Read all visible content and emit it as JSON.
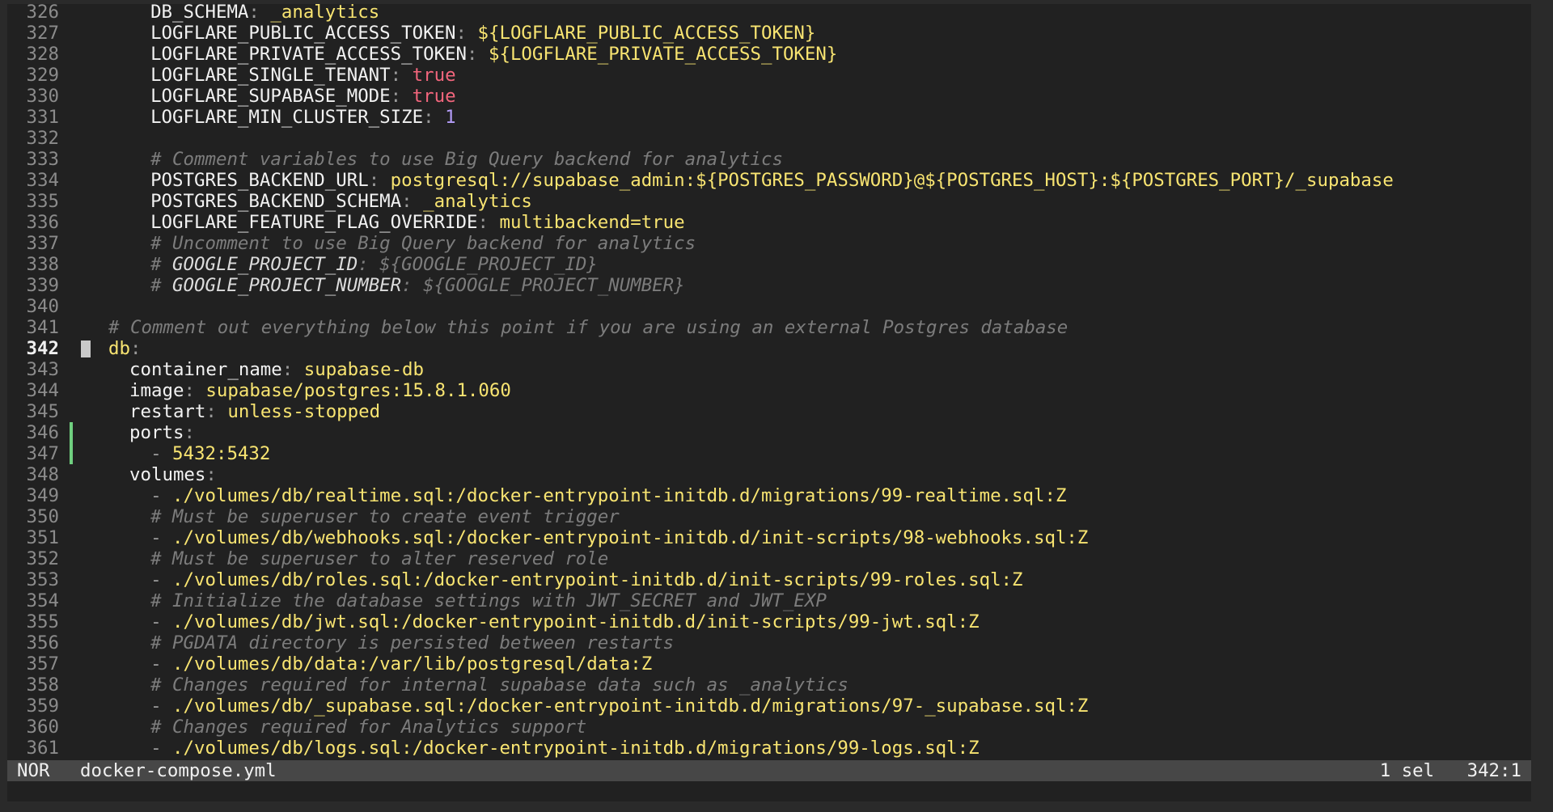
{
  "editor": {
    "cursor_line": 342,
    "lines": [
      {
        "n": "326",
        "indent": 4,
        "tokens": [
          {
            "t": "DB_SCHEMA",
            "c": "key"
          },
          {
            "t": ": ",
            "c": "punct"
          },
          {
            "t": "_analytics",
            "c": "str"
          }
        ]
      },
      {
        "n": "327",
        "indent": 4,
        "tokens": [
          {
            "t": "LOGFLARE_PUBLIC_ACCESS_TOKEN",
            "c": "key"
          },
          {
            "t": ": ",
            "c": "punct"
          },
          {
            "t": "${LOGFLARE_PUBLIC_ACCESS_TOKEN}",
            "c": "str"
          }
        ]
      },
      {
        "n": "328",
        "indent": 4,
        "tokens": [
          {
            "t": "LOGFLARE_PRIVATE_ACCESS_TOKEN",
            "c": "key"
          },
          {
            "t": ": ",
            "c": "punct"
          },
          {
            "t": "${LOGFLARE_PRIVATE_ACCESS_TOKEN}",
            "c": "str"
          }
        ]
      },
      {
        "n": "329",
        "indent": 4,
        "tokens": [
          {
            "t": "LOGFLARE_SINGLE_TENANT",
            "c": "key"
          },
          {
            "t": ": ",
            "c": "punct"
          },
          {
            "t": "true",
            "c": "bool"
          }
        ]
      },
      {
        "n": "330",
        "indent": 4,
        "tokens": [
          {
            "t": "LOGFLARE_SUPABASE_MODE",
            "c": "key"
          },
          {
            "t": ": ",
            "c": "punct"
          },
          {
            "t": "true",
            "c": "bool"
          }
        ]
      },
      {
        "n": "331",
        "indent": 4,
        "tokens": [
          {
            "t": "LOGFLARE_MIN_CLUSTER_SIZE",
            "c": "key"
          },
          {
            "t": ": ",
            "c": "punct"
          },
          {
            "t": "1",
            "c": "num"
          }
        ]
      },
      {
        "n": "332",
        "indent": 0,
        "tokens": []
      },
      {
        "n": "333",
        "indent": 4,
        "tokens": [
          {
            "t": "# Comment variables to use Big Query backend for analytics",
            "c": "comment"
          }
        ]
      },
      {
        "n": "334",
        "indent": 4,
        "tokens": [
          {
            "t": "POSTGRES_BACKEND_URL",
            "c": "key"
          },
          {
            "t": ": ",
            "c": "punct"
          },
          {
            "t": "postgresql://supabase_admin:${POSTGRES_PASSWORD}@${POSTGRES_HOST}:${POSTGRES_PORT}/_supabase",
            "c": "str"
          }
        ]
      },
      {
        "n": "335",
        "indent": 4,
        "tokens": [
          {
            "t": "POSTGRES_BACKEND_SCHEMA",
            "c": "key"
          },
          {
            "t": ": ",
            "c": "punct"
          },
          {
            "t": "_analytics",
            "c": "str"
          }
        ]
      },
      {
        "n": "336",
        "indent": 4,
        "tokens": [
          {
            "t": "LOGFLARE_FEATURE_FLAG_OVERRIDE",
            "c": "key"
          },
          {
            "t": ": ",
            "c": "punct"
          },
          {
            "t": "multibackend=true",
            "c": "str"
          }
        ]
      },
      {
        "n": "337",
        "indent": 4,
        "tokens": [
          {
            "t": "# Uncomment to use Big Query backend for analytics",
            "c": "comment"
          }
        ]
      },
      {
        "n": "338",
        "indent": 4,
        "tokens": [
          {
            "t": "# ",
            "c": "comment"
          },
          {
            "t": "GOOGLE_PROJECT_ID",
            "c": "comment-key"
          },
          {
            "t": ": ${GOOGLE_PROJECT_ID}",
            "c": "comment"
          }
        ]
      },
      {
        "n": "339",
        "indent": 4,
        "tokens": [
          {
            "t": "# ",
            "c": "comment"
          },
          {
            "t": "GOOGLE_PROJECT_NUMBER",
            "c": "comment-key"
          },
          {
            "t": ": ${GOOGLE_PROJECT_NUMBER}",
            "c": "comment"
          }
        ]
      },
      {
        "n": "340",
        "indent": 0,
        "tokens": []
      },
      {
        "n": "341",
        "indent": 0,
        "tokens": [
          {
            "t": "# Comment out everything below this point if you are using an external Postgres database",
            "c": "comment"
          }
        ]
      },
      {
        "n": "342",
        "indent": 0,
        "tokens": [
          {
            "t": "db",
            "c": "key-top"
          },
          {
            "t": ":",
            "c": "punct"
          }
        ]
      },
      {
        "n": "343",
        "indent": 2,
        "tokens": [
          {
            "t": "container_name",
            "c": "key"
          },
          {
            "t": ": ",
            "c": "punct"
          },
          {
            "t": "supabase-db",
            "c": "str"
          }
        ]
      },
      {
        "n": "344",
        "indent": 2,
        "tokens": [
          {
            "t": "image",
            "c": "key"
          },
          {
            "t": ": ",
            "c": "punct"
          },
          {
            "t": "supabase/postgres:15.8.1.060",
            "c": "str"
          }
        ]
      },
      {
        "n": "345",
        "indent": 2,
        "tokens": [
          {
            "t": "restart",
            "c": "key"
          },
          {
            "t": ": ",
            "c": "punct"
          },
          {
            "t": "unless-stopped",
            "c": "str"
          }
        ]
      },
      {
        "n": "346",
        "indent": 2,
        "tokens": [
          {
            "t": "ports",
            "c": "key"
          },
          {
            "t": ":",
            "c": "punct"
          }
        ],
        "changed": true
      },
      {
        "n": "347",
        "indent": 4,
        "tokens": [
          {
            "t": "- ",
            "c": "punct"
          },
          {
            "t": "5432:5432",
            "c": "str"
          }
        ],
        "changed": true
      },
      {
        "n": "348",
        "indent": 2,
        "tokens": [
          {
            "t": "volumes",
            "c": "key"
          },
          {
            "t": ":",
            "c": "punct"
          }
        ]
      },
      {
        "n": "349",
        "indent": 4,
        "tokens": [
          {
            "t": "- ",
            "c": "punct"
          },
          {
            "t": "./volumes/db/realtime.sql:/docker-entrypoint-initdb.d/migrations/99-realtime.sql:Z",
            "c": "str"
          }
        ]
      },
      {
        "n": "350",
        "indent": 4,
        "tokens": [
          {
            "t": "# Must be superuser to create event trigger",
            "c": "comment"
          }
        ]
      },
      {
        "n": "351",
        "indent": 4,
        "tokens": [
          {
            "t": "- ",
            "c": "punct"
          },
          {
            "t": "./volumes/db/webhooks.sql:/docker-entrypoint-initdb.d/init-scripts/98-webhooks.sql:Z",
            "c": "str"
          }
        ]
      },
      {
        "n": "352",
        "indent": 4,
        "tokens": [
          {
            "t": "# Must be superuser to alter reserved role",
            "c": "comment"
          }
        ]
      },
      {
        "n": "353",
        "indent": 4,
        "tokens": [
          {
            "t": "- ",
            "c": "punct"
          },
          {
            "t": "./volumes/db/roles.sql:/docker-entrypoint-initdb.d/init-scripts/99-roles.sql:Z",
            "c": "str"
          }
        ]
      },
      {
        "n": "354",
        "indent": 4,
        "tokens": [
          {
            "t": "# Initialize the database settings with JWT_SECRET and JWT_EXP",
            "c": "comment"
          }
        ]
      },
      {
        "n": "355",
        "indent": 4,
        "tokens": [
          {
            "t": "- ",
            "c": "punct"
          },
          {
            "t": "./volumes/db/jwt.sql:/docker-entrypoint-initdb.d/init-scripts/99-jwt.sql:Z",
            "c": "str"
          }
        ]
      },
      {
        "n": "356",
        "indent": 4,
        "tokens": [
          {
            "t": "# PGDATA directory is persisted between restarts",
            "c": "comment"
          }
        ]
      },
      {
        "n": "357",
        "indent": 4,
        "tokens": [
          {
            "t": "- ",
            "c": "punct"
          },
          {
            "t": "./volumes/db/data:/var/lib/postgresql/data:Z",
            "c": "str"
          }
        ]
      },
      {
        "n": "358",
        "indent": 4,
        "tokens": [
          {
            "t": "# Changes required for internal supabase data such as _analytics",
            "c": "comment"
          }
        ]
      },
      {
        "n": "359",
        "indent": 4,
        "tokens": [
          {
            "t": "- ",
            "c": "punct"
          },
          {
            "t": "./volumes/db/_supabase.sql:/docker-entrypoint-initdb.d/migrations/97-_supabase.sql:Z",
            "c": "str"
          }
        ]
      },
      {
        "n": "360",
        "indent": 4,
        "tokens": [
          {
            "t": "# Changes required for Analytics support",
            "c": "comment"
          }
        ]
      },
      {
        "n": "361",
        "indent": 4,
        "tokens": [
          {
            "t": "- ",
            "c": "punct"
          },
          {
            "t": "./volumes/db/logs.sql:/docker-entrypoint-initdb.d/migrations/99-logs.sql:Z",
            "c": "str"
          }
        ]
      }
    ]
  },
  "statusbar": {
    "mode": "NOR",
    "filename": "docker-compose.yml",
    "selections": "1 sel",
    "position": "342:1"
  },
  "colors": {
    "background": "#212121",
    "string": "#f8e471",
    "boolean": "#f3667d",
    "number": "#b39cf7",
    "comment": "#7c7c7c",
    "statusbar": "#474747",
    "diff_added": "#6fcf7f"
  }
}
